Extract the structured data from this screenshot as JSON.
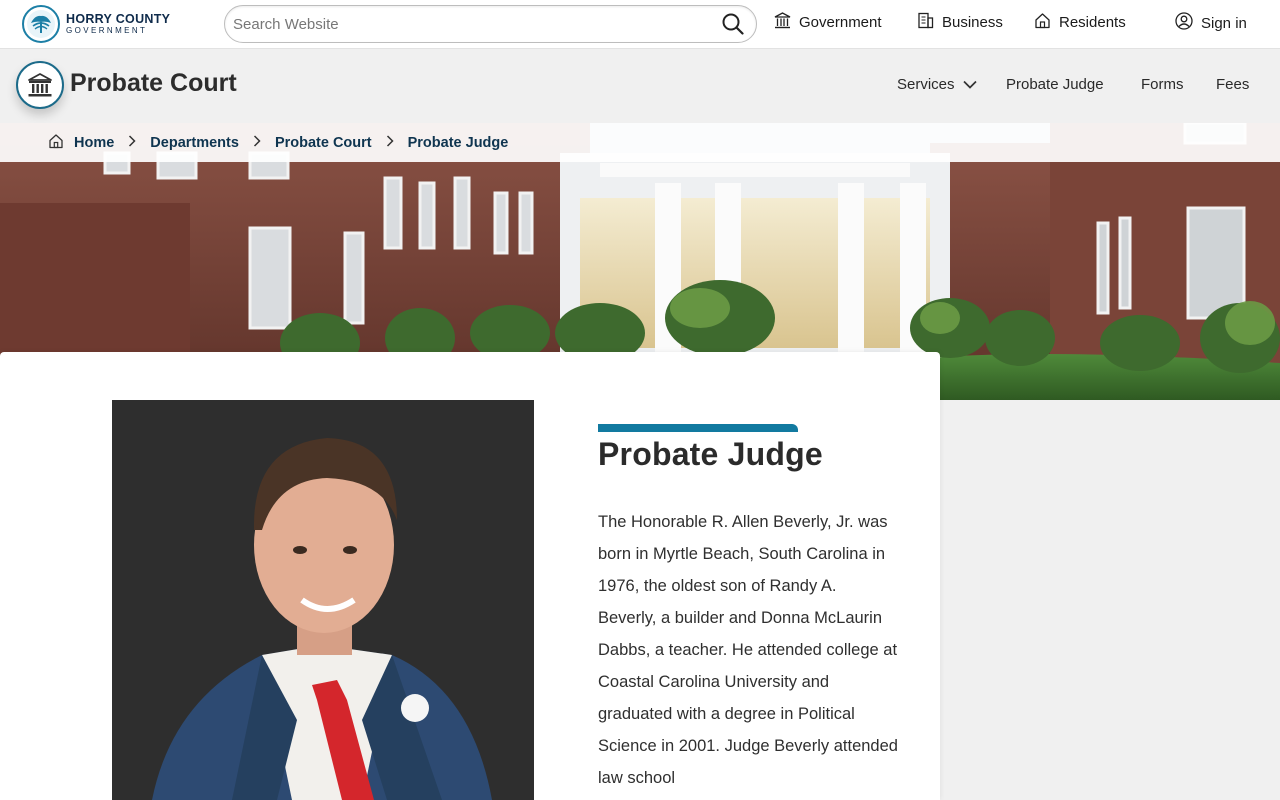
{
  "header": {
    "logo_line1": "HORRY COUNTY",
    "logo_line2": "GOVERNMENT",
    "search_placeholder": "Search Website",
    "nav": [
      {
        "label": "Government",
        "icon": "columns-icon"
      },
      {
        "label": "Business",
        "icon": "building-icon"
      },
      {
        "label": "Residents",
        "icon": "house-icon"
      },
      {
        "label": "Sign in",
        "icon": "user-circle-icon"
      }
    ]
  },
  "department": {
    "title": "Probate Court",
    "icon": "courthouse-icon",
    "nav": [
      "Services",
      "Probate Judge",
      "Forms",
      "Fees"
    ]
  },
  "breadcrumb": [
    "Home",
    "Departments",
    "Probate Court",
    "Probate Judge"
  ],
  "main": {
    "title": "Probate Judge",
    "bio": "The Honorable R. Allen Beverly, Jr. was born in Myrtle Beach, South Carolina in 1976, the oldest son of Randy A. Beverly, a builder and Donna McLaurin Dabbs, a teacher. He attended college at Coastal Carolina University and graduated with a degree in Political Science in 2001. Judge Beverly attended law school"
  },
  "colors": {
    "accent": "#127aa0",
    "navy": "#0f3550",
    "background": "#f0f0f0"
  }
}
